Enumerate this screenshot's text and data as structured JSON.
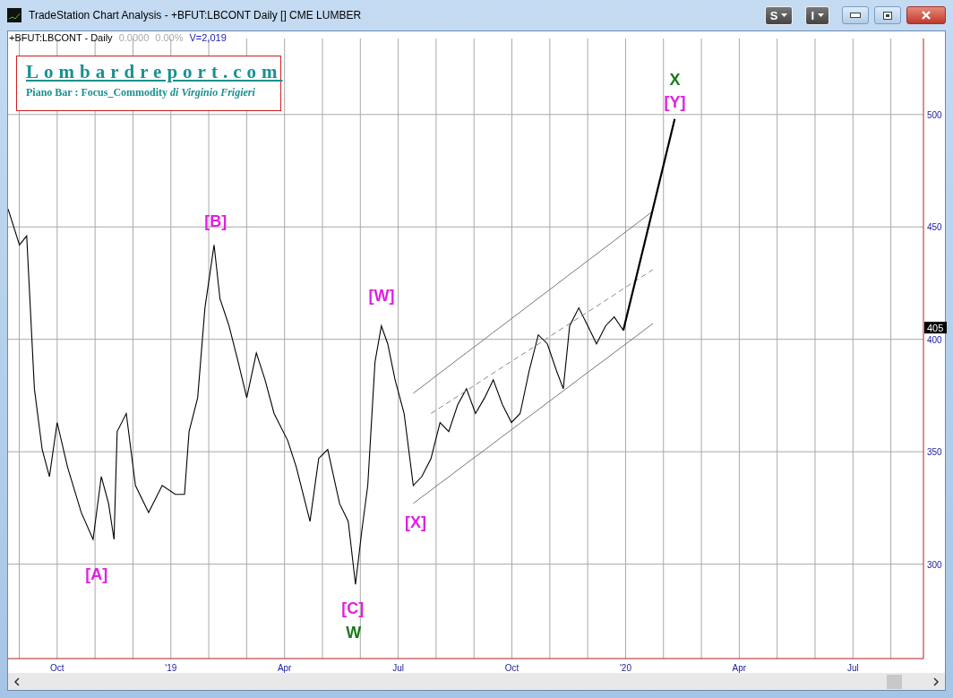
{
  "window": {
    "title": "TradeStation Chart Analysis - +BFUT:LBCONT Daily [] CME LUMBER",
    "buttons": [
      {
        "label": "S"
      },
      {
        "label": "I"
      }
    ]
  },
  "chart_header": {
    "symbol": "+BFUT:LBCONT - Daily",
    "change": "0.0000",
    "change_percent": "0.00%",
    "volume": "V=2,019"
  },
  "logo": {
    "title": "Lombardreport.com",
    "subtitle": "Piano Bar : Focus_Commodity *di Virginio Frigieri*"
  },
  "last_price": "405",
  "wave_labels": [
    {
      "text": "[A]",
      "color": "#e020e0"
    },
    {
      "text": "[B]",
      "color": "#e020e0"
    },
    {
      "text": "[W]",
      "color": "#e020e0"
    },
    {
      "text": "[X]",
      "color": "#e020e0"
    },
    {
      "text": "[C]",
      "color": "#e020e0"
    },
    {
      "text": "W",
      "color": "#1a7a1a"
    },
    {
      "text": "X",
      "color": "#1a7a1a"
    },
    {
      "text": "[Y]",
      "color": "#e020e0"
    }
  ],
  "chart": {
    "chart_data": {
      "type": "line",
      "grid": true,
      "xlim": [
        2018.642,
        2020.655
      ],
      "ylim": [
        258,
        533.8
      ],
      "xticks": [
        {
          "value": 2018.75,
          "label": "Oct"
        },
        {
          "value": 2019,
          "label": "'19"
        },
        {
          "value": 2019.25,
          "label": "Apr"
        },
        {
          "value": 2019.5,
          "label": "Jul"
        },
        {
          "value": 2019.75,
          "label": "Oct"
        },
        {
          "value": 2020,
          "label": "'20"
        },
        {
          "value": 2020.25,
          "label": "Apr"
        },
        {
          "value": 2020.5,
          "label": "Jul"
        }
      ],
      "yticks": [
        300,
        350,
        400,
        450,
        500
      ],
      "x": [
        2018.642,
        2018.667,
        2018.683,
        2018.7,
        2018.717,
        2018.733,
        2018.75,
        2018.773,
        2018.803,
        2018.829,
        2018.847,
        2018.863,
        2018.875,
        2018.882,
        2018.902,
        2018.922,
        2018.951,
        2018.981,
        2019.01,
        2019.03,
        2019.04,
        2019.059,
        2019.075,
        2019.095,
        2019.108,
        2019.128,
        2019.148,
        2019.167,
        2019.188,
        2019.207,
        2019.227,
        2019.257,
        2019.276,
        2019.306,
        2019.325,
        2019.345,
        2019.371,
        2019.39,
        2019.406,
        2019.42,
        2019.433,
        2019.449,
        2019.463,
        2019.477,
        2019.493,
        2019.513,
        2019.533,
        2019.552,
        2019.572,
        2019.592,
        2019.611,
        2019.631,
        2019.65,
        2019.67,
        2019.69,
        2019.709,
        2019.729,
        2019.749,
        2019.768,
        2019.788,
        2019.808,
        2019.828,
        2019.848,
        2019.863,
        2019.877,
        2019.897,
        2019.917,
        2019.936,
        2019.956,
        2019.975,
        2019.995,
        2020.06,
        2020.108
      ],
      "series": [
        {
          "color": "#000000",
          "values": [
            458,
            442,
            446,
            378,
            351,
            339,
            363,
            343,
            323,
            311,
            339,
            327,
            311,
            359,
            367,
            335,
            323,
            335,
            331,
            331,
            359,
            374,
            414,
            442,
            418,
            406,
            390,
            374,
            394,
            382,
            367,
            355,
            343,
            319,
            347,
            351,
            327,
            319,
            291,
            315,
            335,
            390,
            406,
            398,
            382,
            367,
            335,
            339,
            347,
            363,
            359,
            371,
            378,
            367,
            374,
            382,
            371,
            363,
            367,
            386,
            402,
            398,
            386,
            378,
            406,
            414,
            406,
            398,
            406,
            410,
            404,
            null,
            null
          ]
        },
        {
          "color": "#777777",
          "values": [
            null,
            null,
            null,
            null,
            null,
            null,
            null,
            null,
            null,
            null,
            null,
            null,
            null,
            null,
            null,
            null,
            null,
            null,
            null,
            null,
            null,
            null,
            null,
            null,
            null,
            null,
            null,
            null,
            null,
            null,
            null,
            null,
            null,
            null,
            null,
            null,
            null,
            null,
            null,
            null,
            null,
            null,
            null,
            null,
            null,
            null,
            376,
            378.9,
            382,
            385.1,
            388,
            391.1,
            394,
            397.1,
            400.1,
            403.1,
            406.1,
            409.2,
            412.1,
            415.2,
            418.3,
            421.3,
            424.4,
            426.7,
            428.9,
            431.9,
            435,
            437.9,
            441,
            443.9,
            447,
            457,
            null
          ]
        },
        {
          "color": "#777777",
          "values": [
            null,
            null,
            null,
            null,
            null,
            null,
            null,
            null,
            null,
            null,
            null,
            null,
            null,
            null,
            null,
            null,
            null,
            null,
            null,
            null,
            null,
            null,
            null,
            null,
            null,
            null,
            null,
            null,
            null,
            null,
            null,
            null,
            null,
            null,
            null,
            null,
            null,
            null,
            null,
            null,
            null,
            null,
            null,
            null,
            null,
            null,
            327,
            329.9,
            332.9,
            336,
            338.8,
            341.9,
            344.8,
            347.8,
            350.8,
            353.7,
            356.8,
            359.8,
            362.7,
            365.7,
            368.7,
            371.8,
            374.8,
            377.1,
            379.2,
            382.3,
            385.3,
            388.2,
            391.2,
            394.1,
            397.1,
            407,
            null
          ]
        },
        {
          "color": "#888888",
          "line_style": "dashed",
          "values": [
            null,
            null,
            null,
            null,
            null,
            null,
            null,
            null,
            null,
            null,
            null,
            null,
            null,
            null,
            null,
            null,
            null,
            null,
            null,
            null,
            null,
            null,
            null,
            null,
            null,
            null,
            null,
            null,
            null,
            null,
            null,
            null,
            null,
            null,
            null,
            null,
            null,
            null,
            null,
            null,
            null,
            null,
            null,
            null,
            null,
            null,
            null,
            null,
            367,
            369.6,
            372.1,
            374.7,
            377.2,
            379.8,
            382.5,
            385,
            387.6,
            390.2,
            392.7,
            395.3,
            397.9,
            400.6,
            403.2,
            405.2,
            407,
            409.6,
            412.2,
            414.7,
            417.3,
            419.8,
            422.5,
            431,
            null
          ]
        },
        {
          "color": "#000000",
          "values": [
            null,
            null,
            null,
            null,
            null,
            null,
            null,
            null,
            null,
            null,
            null,
            null,
            null,
            null,
            null,
            null,
            null,
            null,
            null,
            null,
            null,
            null,
            null,
            null,
            null,
            null,
            null,
            null,
            null,
            null,
            null,
            null,
            null,
            null,
            null,
            null,
            null,
            null,
            null,
            null,
            null,
            null,
            null,
            null,
            null,
            null,
            null,
            null,
            null,
            null,
            null,
            null,
            null,
            null,
            null,
            null,
            null,
            null,
            null,
            null,
            null,
            null,
            null,
            null,
            null,
            null,
            null,
            null,
            null,
            null,
            404,
            458,
            498
          ]
        }
      ]
    }
  }
}
